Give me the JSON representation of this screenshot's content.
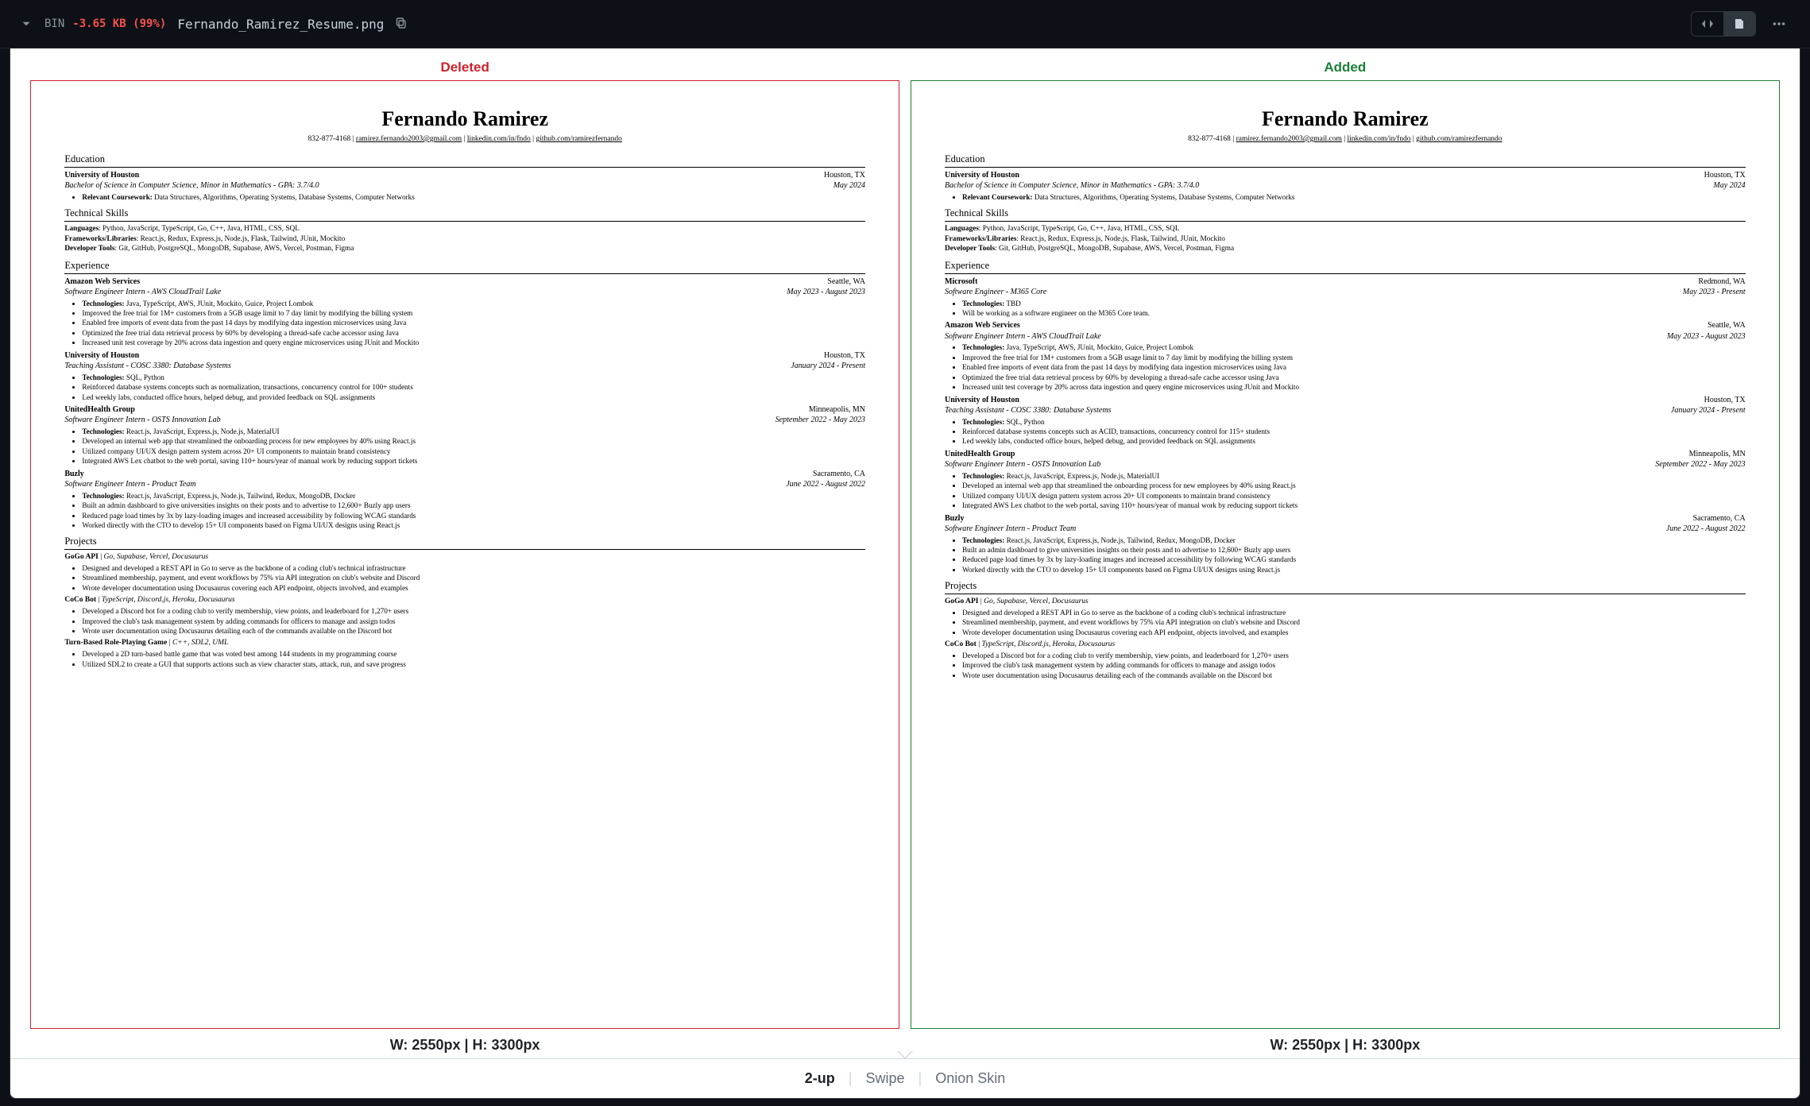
{
  "header": {
    "bin": "BIN",
    "delta": "-3.65 KB (99%)",
    "filename": "Fernando_Ramirez_Resume.png"
  },
  "labels": {
    "deleted": "Deleted",
    "added": "Added"
  },
  "dims": {
    "text": "W: 2550px | H: 3300px"
  },
  "modes": {
    "two_up": "2-up",
    "swipe": "Swipe",
    "onion": "Onion Skin"
  },
  "contact": {
    "name": "Fernando Ramirez",
    "phone": "832-877-4168",
    "email": "ramirez.fernando2003@gmail.com",
    "linkedin": "linkedin.com/in/fndo",
    "github": "github.com/ramirezfernando"
  },
  "sections": {
    "education": "Education",
    "skills": "Technical Skills",
    "experience": "Experience",
    "projects": "Projects"
  },
  "education": {
    "school": "University of Houston",
    "loc": "Houston, TX",
    "degree": "Bachelor of Science in Computer Science, Minor in Mathematics - GPA: 3.7/4.0",
    "date": "May 2024",
    "coursework_label": "Relevant Coursework:",
    "coursework": " Data Structures, Algorithms, Operating Systems, Database Systems, Computer Networks"
  },
  "skills": {
    "l1a": "Languages",
    "l1b": ": Python, JavaScript, TypeScript, Go, C++, Java, HTML, CSS, SQL",
    "l2a": "Frameworks/Libraries",
    "l2b": ": React.js, Redux, Express.js, Node.js, Flask, Tailwind, JUnit, Mockito",
    "l3a": "Developer Tools",
    "l3b": ": Git, GitHub, PostgreSQL, MongoDB, Supabase, AWS, Vercel, Postman, Figma"
  },
  "deleted": {
    "exp": [
      {
        "company": "Amazon Web Services",
        "loc": "Seattle, WA",
        "role": "Software Engineer Intern - AWS CloudTrail Lake",
        "date": "May 2023 - August 2023",
        "bullets": [
          "**Technologies:** Java, TypeScript, AWS, JUnit, Mockito, Guice, Project Lombok",
          "Improved the free trial for 1M+ customers from a 5GB usage limit to 7 day limit by modifying the billing system",
          "Enabled free imports of event data from the past 14 days by modifying data ingestion microservices using Java",
          "Optimized the free trial data retrieval process by 60% by developing a thread-safe cache accessor using Java",
          "Increased unit test coverage by 20% across data ingestion and query engine microservices using JUnit and Mockito"
        ]
      },
      {
        "company": "University of Houston",
        "loc": "Houston, TX",
        "role": "Teaching Assistant - COSC 3380: Database Systems",
        "date": "January 2024 - Present",
        "bullets": [
          "**Technologies:** SQL, Python",
          "Reinforced database systems concepts such as normalization, transactions, concurrency control for 100+ students",
          "Led weekly labs, conducted office hours, helped debug, and provided feedback on SQL assignments"
        ]
      },
      {
        "company": "UnitedHealth Group",
        "loc": "Minneapolis, MN",
        "role": "Software Engineer Intern - OSTS Innovation Lab",
        "date": "September 2022 - May 2023",
        "bullets": [
          "**Technologies:** React.js, JavaScript, Express.js, Node.js, MaterialUI",
          "Developed an internal web app that streamlined the onboarding process for new employees by 40% using React.js",
          "Utilized company UI/UX design pattern system across 20+ UI components to maintain brand consistency",
          "Integrated AWS Lex chatbot to the web portal, saving 110+ hours/year of manual work by reducing support tickets"
        ]
      },
      {
        "company": "Buzly",
        "loc": "Sacramento, CA",
        "role": "Software Engineer Intern - Product Team",
        "date": "June 2022 - August 2022",
        "bullets": [
          "**Technologies:** React.js, JavaScript, Express.js, Node.js, Tailwind, Redux, MongoDB, Docker",
          "Built an admin dashboard to give universities insights on their posts and to advertise to 12,600+ Buzly app users",
          "Reduced page load times by 3x by lazy-loading images and increased accessibility by following WCAG standards",
          "Worked directly with the CTO to develop 15+ UI components based on Figma UI/UX designs using React.js"
        ]
      }
    ],
    "projects": [
      {
        "name": "GoGo API",
        "tech": "Go, Supabase, Vercel, Docusaurus",
        "bullets": [
          "Designed and developed a REST API in Go to serve as the backbone of a coding club's technical infrastructure",
          "Streamlined membership, payment, and event workflows by 75% via API integration on club's website and Discord",
          "Wrote developer documentation using Docusaurus covering each API endpoint, objects involved, and examples"
        ]
      },
      {
        "name": "CoCo Bot",
        "tech": "TypeScript, Discord.js, Heroku, Docusaurus",
        "bullets": [
          "Developed a Discord bot for a coding club to verify membership, view points, and leaderboard for 1,270+ users",
          "Improved the club's task management system by adding commands for officers to manage and assign todos",
          "Wrote user documentation using Docusaurus detailing each of the commands available on the Discord bot"
        ]
      },
      {
        "name": "Turn-Based Role-Playing Game",
        "tech": "C++, SDL2, UML",
        "bullets": [
          "Developed a 2D turn-based battle game that was voted best among 144 students in my programming course",
          "Utilized SDL2 to create a GUI that supports actions such as view character stats, attack, run, and save progress"
        ]
      }
    ]
  },
  "added": {
    "exp": [
      {
        "company": "Microsoft",
        "loc": "Redmond, WA",
        "role": "Software Engineer - M365 Core",
        "date": "May 2023 - Present",
        "bullets": [
          "**Technologies:** TBD",
          "Will be working as a software engineer on the M365 Core team."
        ]
      },
      {
        "company": "Amazon Web Services",
        "loc": "Seattle, WA",
        "role": "Software Engineer Intern - AWS CloudTrail Lake",
        "date": "May 2023 - August 2023",
        "bullets": [
          "**Technologies:** Java, TypeScript, AWS, JUnit, Mockito, Guice, Project Lombok",
          "Improved the free trial for 1M+ customers from a 5GB usage limit to 7 day limit by modifying the billing system",
          "Enabled free imports of event data from the past 14 days by modifying data ingestion microservices using Java",
          "Optimized the free trial data retrieval process by 60% by developing a thread-safe cache accessor using Java",
          "Increased unit test coverage by 20% across data ingestion and query engine microservices using JUnit and Mockito"
        ]
      },
      {
        "company": "University of Houston",
        "loc": "Houston, TX",
        "role": "Teaching Assistant - COSC 3380: Database Systems",
        "date": "January 2024 - Present",
        "bullets": [
          "**Technologies:** SQL, Python",
          "Reinforced database systems concepts such as ACID, transactions, concurrency control for 115+ students",
          "Led weekly labs, conducted office hours, helped debug, and provided feedback on SQL assignments"
        ]
      },
      {
        "company": "UnitedHealth Group",
        "loc": "Minneapolis, MN",
        "role": "Software Engineer Intern - OSTS Innovation Lab",
        "date": "September 2022 - May 2023",
        "bullets": [
          "**Technologies:** React.js, JavaScript, Express.js, Node.js, MaterialUI",
          "Developed an internal web app that streamlined the onboarding process for new employees by 40% using React.js",
          "Utilized company UI/UX design pattern system across 20+ UI components to maintain brand consistency",
          "Integrated AWS Lex chatbot to the web portal, saving 110+ hours/year of manual work by reducing support tickets"
        ]
      },
      {
        "company": "Buzly",
        "loc": "Sacramento, CA",
        "role": "Software Engineer Intern - Product Team",
        "date": "June 2022 - August 2022",
        "bullets": [
          "**Technologies:** React.js, JavaScript, Express.js, Node.js, Tailwind, Redux, MongoDB, Docker",
          "Built an admin dashboard to give universities insights on their posts and to advertise to 12,600+ Buzly app users",
          "Reduced page load times by 3x by lazy-loading images and increased accessibility by following WCAG standards",
          "Worked directly with the CTO to develop 15+ UI components based on Figma UI/UX designs using React.js"
        ]
      }
    ],
    "projects": [
      {
        "name": "GoGo API",
        "tech": "Go, Supabase, Vercel, Docusaurus",
        "bullets": [
          "Designed and developed a REST API in Go to serve as the backbone of a coding club's technical infrastructure",
          "Streamlined membership, payment, and event workflows by 75% via API integration on club's website and Discord",
          "Wrote developer documentation using Docusaurus covering each API endpoint, objects involved, and examples"
        ]
      },
      {
        "name": "CoCo Bot",
        "tech": "TypeScript, Discord.js, Heroku, Docusaurus",
        "bullets": [
          "Developed a Discord bot for a coding club to verify membership, view points, and leaderboard for 1,270+ users",
          "Improved the club's task management system by adding commands for officers to manage and assign todos",
          "Wrote user documentation using Docusaurus detailing each of the commands available on the Discord bot"
        ]
      }
    ]
  }
}
